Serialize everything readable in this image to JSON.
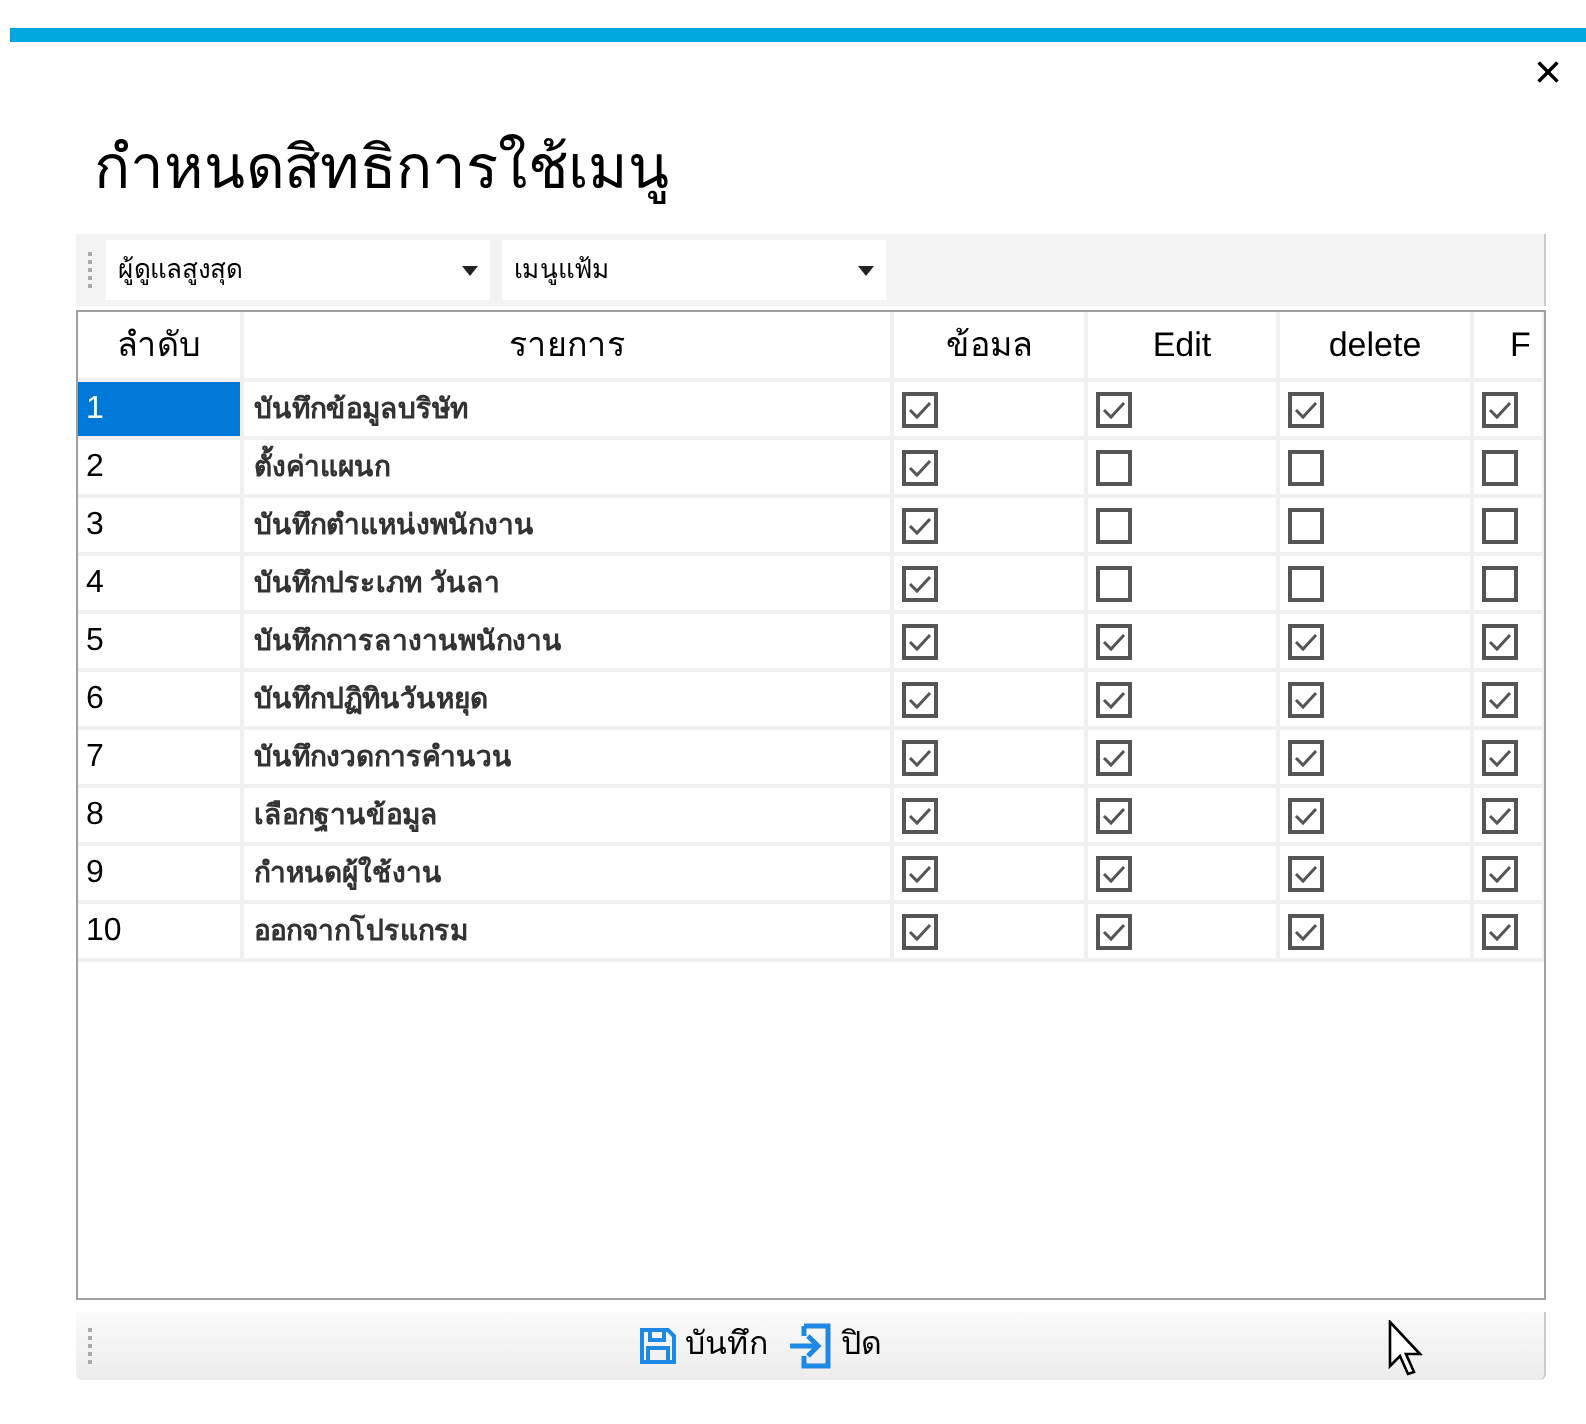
{
  "window": {
    "title": "กำหนดสิทธิการใช้เมนู",
    "close": "×"
  },
  "toolbar": {
    "combos": [
      {
        "value": "ผู้ดูแลสูงสุด"
      },
      {
        "value": "เมนูแฟ้ม"
      }
    ]
  },
  "table": {
    "columns": [
      "ลำดับ",
      "รายการ",
      "ข้อมล",
      "Edit",
      "delete",
      "F"
    ],
    "rows": [
      {
        "no": "1",
        "item": "บันทึกข้อมูลบริษัท",
        "selected": true,
        "checks": [
          true,
          true,
          true,
          true
        ]
      },
      {
        "no": "2",
        "item": "ตั้งค่าแผนก",
        "selected": false,
        "checks": [
          true,
          false,
          false,
          false
        ]
      },
      {
        "no": "3",
        "item": "บันทึกตำแหน่งพนักงาน",
        "selected": false,
        "checks": [
          true,
          false,
          false,
          false
        ]
      },
      {
        "no": "4",
        "item": "บันทึกประเภท วันลา",
        "selected": false,
        "checks": [
          true,
          false,
          false,
          false
        ]
      },
      {
        "no": "5",
        "item": "บันทึกการลางานพนักงาน",
        "selected": false,
        "checks": [
          true,
          true,
          true,
          true
        ]
      },
      {
        "no": "6",
        "item": "บันทึกปฏิทินวันหยุด",
        "selected": false,
        "checks": [
          true,
          true,
          true,
          true
        ]
      },
      {
        "no": "7",
        "item": "บันทึกงวดการคำนวน",
        "selected": false,
        "checks": [
          true,
          true,
          true,
          true
        ]
      },
      {
        "no": "8",
        "item": "เลือกฐานข้อมูล",
        "selected": false,
        "checks": [
          true,
          true,
          true,
          true
        ]
      },
      {
        "no": "9",
        "item": "กำหนดผู้ใช้งาน",
        "selected": false,
        "checks": [
          true,
          true,
          true,
          true
        ]
      },
      {
        "no": "10",
        "item": "ออกจากโปรแกรม",
        "selected": false,
        "checks": [
          true,
          true,
          true,
          true
        ]
      }
    ]
  },
  "buttons": [
    {
      "kind": "save",
      "label": "บันทึก"
    },
    {
      "kind": "close",
      "label": "ปิด"
    }
  ]
}
